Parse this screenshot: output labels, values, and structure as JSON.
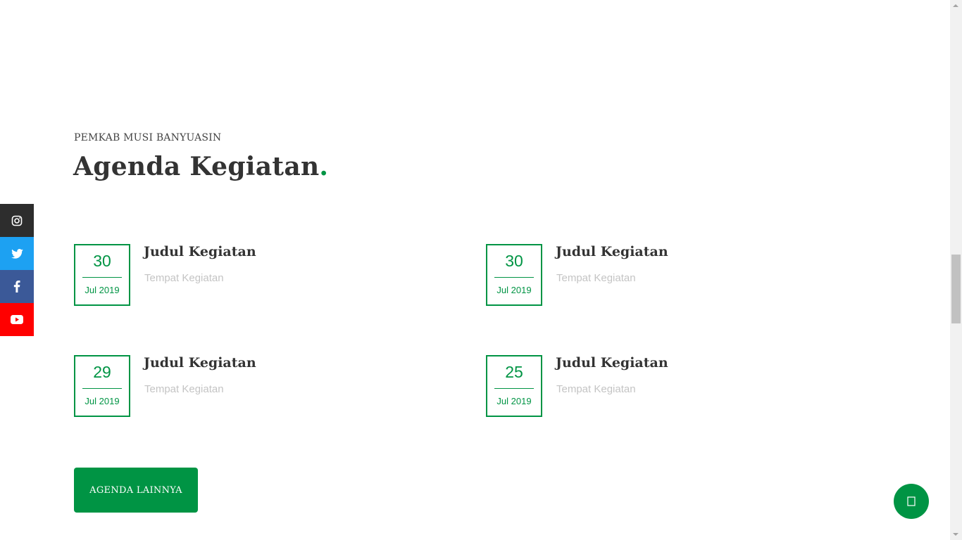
{
  "section": {
    "kicker": "PEMKAB MUSI BANYUASIN",
    "title": "Agenda Kegiatan",
    "title_dot": "."
  },
  "social": [
    {
      "icon": "instagram-icon",
      "color": "#2d2d2d"
    },
    {
      "icon": "twitter-icon",
      "color": "#1da1f2"
    },
    {
      "icon": "facebook-icon",
      "color": "#3b5998"
    },
    {
      "icon": "youtube-icon",
      "color": "#ff0000"
    }
  ],
  "agenda": [
    {
      "day": "30",
      "month": "Jul 2019",
      "title": "Judul Kegiatan",
      "place": "Tempat Kegiatan"
    },
    {
      "day": "30",
      "month": "Jul 2019",
      "title": "Judul Kegiatan",
      "place": "Tempat Kegiatan"
    },
    {
      "day": "29",
      "month": "Jul 2019",
      "title": "Judul Kegiatan",
      "place": "Tempat Kegiatan"
    },
    {
      "day": "25",
      "month": "Jul 2019",
      "title": "Judul Kegiatan",
      "place": "Tempat Kegiatan"
    }
  ],
  "more_button": {
    "label": "AGENDA LAINNYA"
  },
  "floating_button": {
    "icon": "chat-icon"
  },
  "colors": {
    "accent": "#009444",
    "heading": "#333333",
    "muted": "#c4c4c4"
  }
}
